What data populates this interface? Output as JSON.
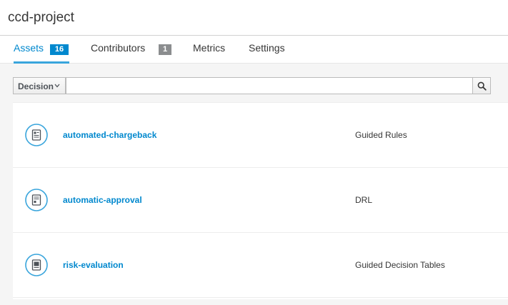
{
  "project": {
    "title": "ccd-project"
  },
  "tabs": [
    {
      "label": "Assets",
      "badge": "16",
      "badge_color": "#0088ce",
      "active": true
    },
    {
      "label": "Contributors",
      "badge": "1",
      "badge_color": "#8b8d8f",
      "active": false
    },
    {
      "label": "Metrics",
      "badge": null,
      "active": false
    },
    {
      "label": "Settings",
      "badge": null,
      "active": false
    }
  ],
  "toolbar": {
    "filter_label": "Decision",
    "filter_icon": "chevron-down-icon",
    "search_value": "",
    "search_icon": "search-icon"
  },
  "assets": [
    {
      "name": "automated-chargeback",
      "type": "Guided Rules",
      "icon": "guided-rule-icon"
    },
    {
      "name": "automatic-approval",
      "type": "DRL",
      "icon": "drl-file-icon"
    },
    {
      "name": "risk-evaluation",
      "type": "Guided Decision Tables",
      "icon": "decision-table-icon"
    }
  ],
  "colors": {
    "accent": "#0088ce",
    "tab_underline": "#39a5dc",
    "icon_ring": "#39a5dc"
  }
}
